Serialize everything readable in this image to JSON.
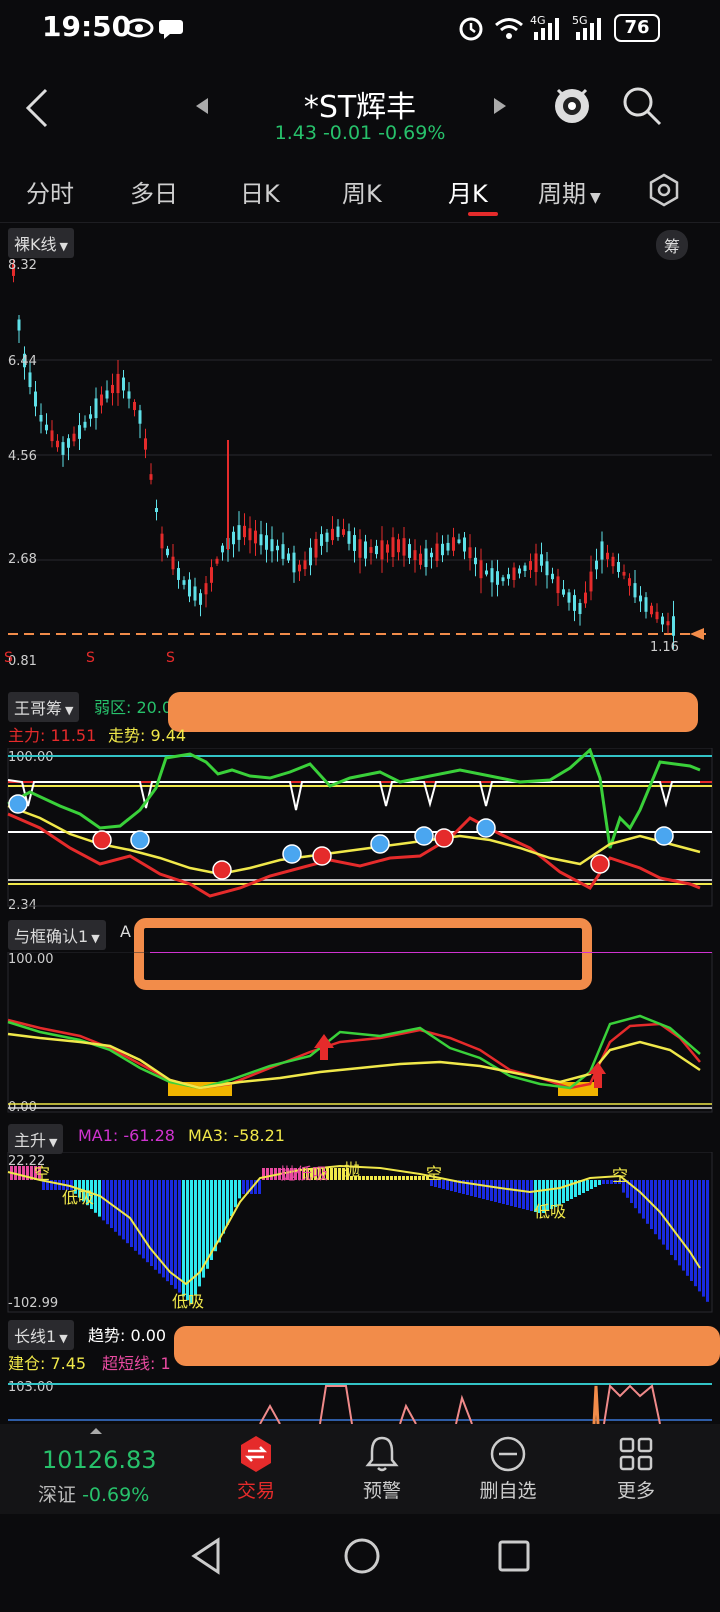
{
  "status_bar": {
    "time": "19:50",
    "battery": "76"
  },
  "header": {
    "title": "*ST辉丰",
    "price_line": "1.43 -0.01 -0.69%"
  },
  "tabs": [
    {
      "label": "分时"
    },
    {
      "label": "多日"
    },
    {
      "label": "日K"
    },
    {
      "label": "周K"
    },
    {
      "label": "月K"
    },
    {
      "label": "周期"
    }
  ],
  "kline": {
    "chip_label": "裸K线",
    "right_chip": "筹",
    "y_labels": [
      "8.32",
      "6.44",
      "4.56",
      "2.68",
      "0.81"
    ],
    "current_price_label": "1.16",
    "s_marks": [
      "S",
      "S",
      "S"
    ]
  },
  "panel1": {
    "chip_label": "王哥筹",
    "weak_zone": "弱区: 20.0",
    "main_force": "主力: 11.51",
    "trend": "走势: 9.44",
    "y_top": "100.00",
    "y_bottom": "2.34"
  },
  "panel2": {
    "chip_label": "与框确认1",
    "partial": "A",
    "y_top": "100.00",
    "y_bottom": "0.00"
  },
  "panel3": {
    "chip_label": "主升",
    "ma1": "MA1: -61.28",
    "ma3": "MA3: -58.21",
    "y_top": "22.22",
    "y_bottom": "-102.99",
    "annotations": [
      "空",
      "低吸",
      "抛低吸",
      "抛",
      "空",
      "空",
      "低吸",
      "低吸"
    ]
  },
  "panel4": {
    "chip_label": "长线1",
    "trend": "趋势: 0.00",
    "build": "建仓: 7.45",
    "short": "超短线: 1",
    "y_top": "103.00"
  },
  "bottom_nav": {
    "index_value": "10126.83",
    "index_name": "深证",
    "index_change": "-0.69%",
    "items": [
      {
        "label": "交易"
      },
      {
        "label": "预警"
      },
      {
        "label": "删自选"
      },
      {
        "label": "更多"
      }
    ]
  },
  "colors": {
    "up": "#e52b2b",
    "down": "#5fe0e8",
    "green": "#27c16b",
    "accent_orange": "#f28c4a"
  }
}
